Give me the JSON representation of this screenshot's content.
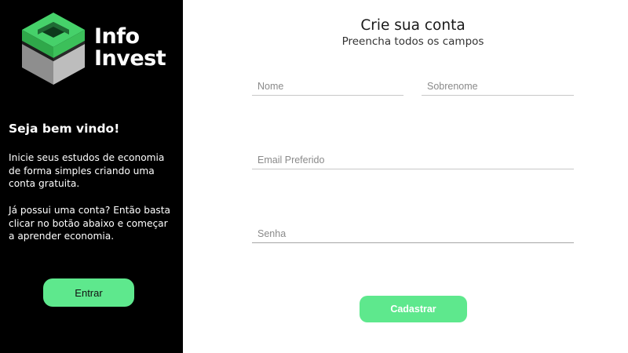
{
  "sidebar": {
    "logo": {
      "line1": "Info",
      "line2": "Invest"
    },
    "welcome": "Seja bem vindo!",
    "intro": "Inicie seus estudos de economia de forma simples criando uma conta gratuita.",
    "already": "Já possui uma conta? Então basta clicar no botão abaixo e começar a aprender economia.",
    "enter_label": "Entrar"
  },
  "form": {
    "title": "Crie sua conta",
    "subtitle": "Preencha todos os campos",
    "first_name_placeholder": "Nome",
    "last_name_placeholder": "Sobrenome",
    "email_placeholder": "Email Preferido",
    "password_placeholder": "Senha",
    "submit_label": "Cadastrar"
  },
  "colors": {
    "accent": "#5ee88d",
    "sidebar_bg": "#000000",
    "logo_green": "#3fbf5a",
    "logo_gray": "#9a9a9a"
  },
  "icons": {
    "logo": "cube-logo-icon"
  }
}
